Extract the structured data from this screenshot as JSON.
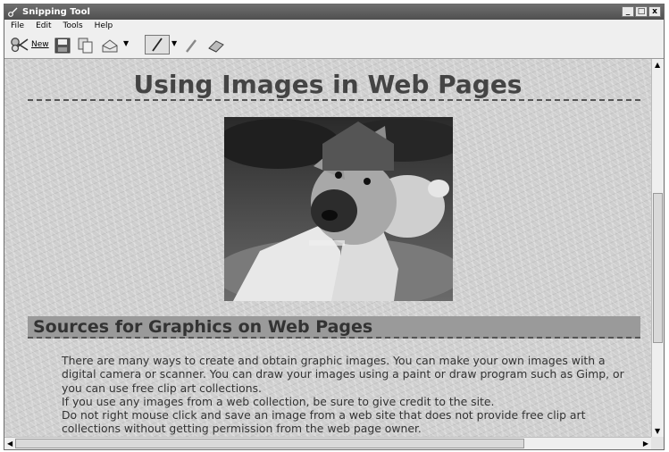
{
  "window": {
    "title": "Snipping Tool",
    "buttons": {
      "minimize": "_",
      "maximize": "□",
      "close": "x"
    }
  },
  "menu": {
    "file": "File",
    "edit": "Edit",
    "tools": "Tools",
    "help": "Help"
  },
  "toolbar": {
    "new_label": "New"
  },
  "icons": [
    "snip-scissors-icon",
    "save-icon",
    "copy-icon",
    "send-snip-icon",
    "dropdown-arrow-icon",
    "pen-icon",
    "highlighter-icon",
    "eraser-icon"
  ],
  "page": {
    "title": "Using Images in Web Pages",
    "section_heading": "Sources for Graphics on Web Pages",
    "paragraphs": [
      "There are many ways to create and obtain graphic images. You can make your own images with a digital camera or scanner. You can draw your images using a paint or draw program such as Gimp, or you can use free clip art collections.",
      "If you use any images from a web collection, be sure to give credit to the site.",
      "Do not right mouse click and save an image from a web site that does not provide free clip art collections without getting permission from the web page owner."
    ]
  }
}
